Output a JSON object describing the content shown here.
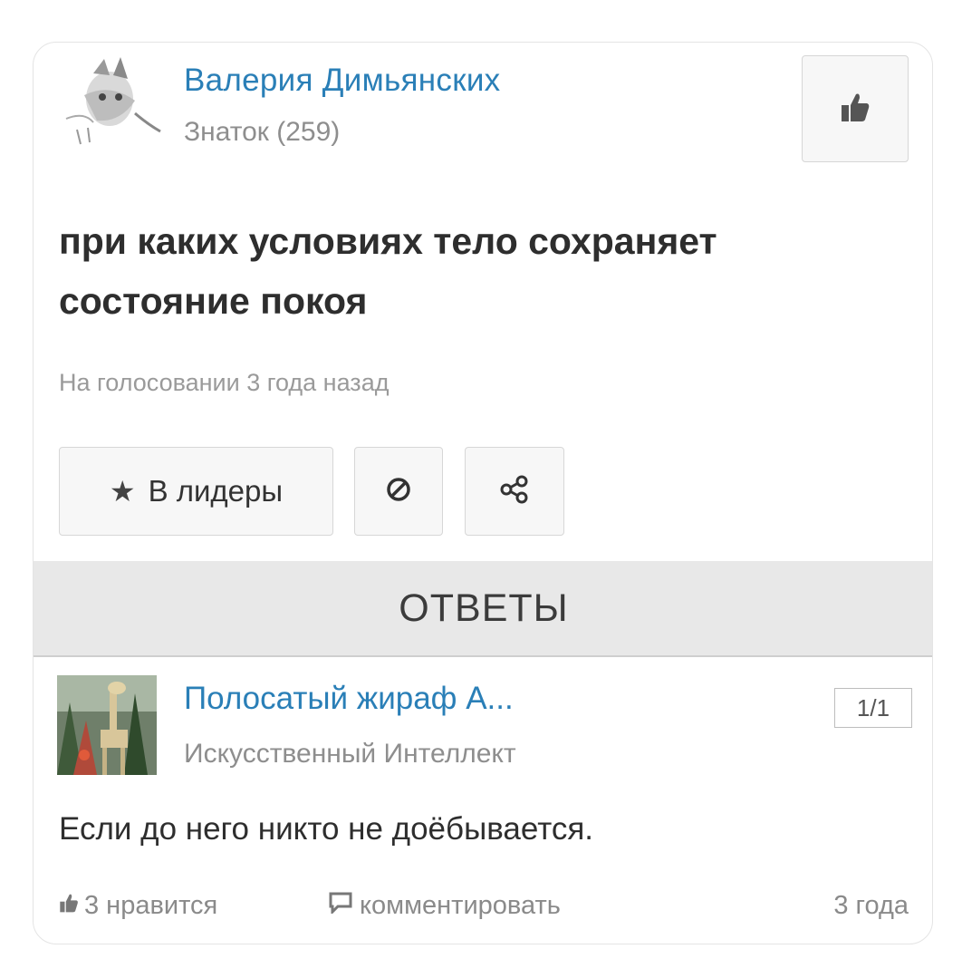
{
  "question": {
    "author": "Валерия Димьянских",
    "rank": "Знаток (259)",
    "title": "при каких условиях тело сохраняет состояние покоя",
    "status": "На голосовании 3 года назад",
    "like_icon": "thumbs-up-icon"
  },
  "actions": {
    "leaders_label": "В лидеры",
    "leaders_icon": "star-icon",
    "block_icon": "block-icon",
    "share_icon": "share-icon"
  },
  "answers_header": "ОТВЕТЫ",
  "answer": {
    "author": "Полосатый жираф А...",
    "rank": "Искусственный Интеллект",
    "counter": "1/1",
    "text": "Если до него никто не доёбывается.",
    "likes": "3 нравится",
    "comment_label": "комментировать",
    "time": "3 года"
  },
  "colors": {
    "link": "#2a7fb7",
    "muted": "#8e8e8e",
    "header_bg": "#e8e8e8"
  }
}
